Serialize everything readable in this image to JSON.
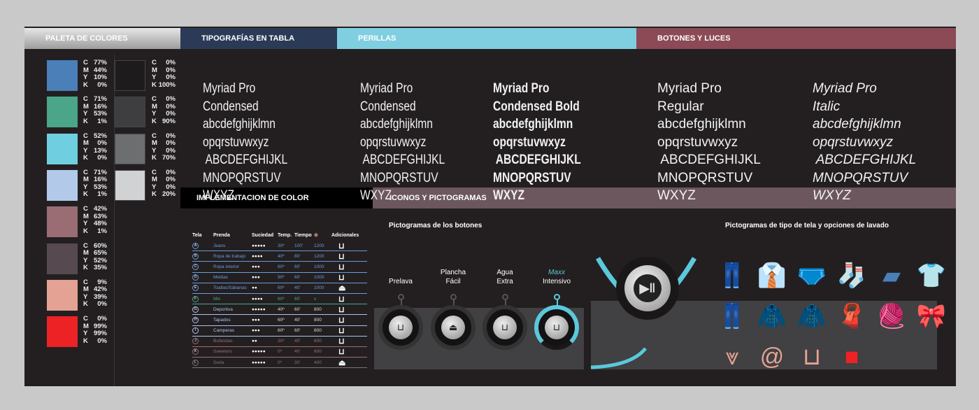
{
  "headers": {
    "palette": "PALETA DE COLORES",
    "typography": "TIPOGRAFÍAS EN   TABLA",
    "knobs": "PERILLAS",
    "buttons": "BOTONES Y LUCES",
    "implementation": "IMPLEMENTACION DE COLOR",
    "icons": "ICONOS Y PICTOGRAMAS"
  },
  "colors": {
    "board": "#231f20",
    "palette_header": "#bdbdbd",
    "typo_header": "#2b3b57",
    "knobs_header": "#7fcfe1",
    "buttons_header": "#8c4a56",
    "icons_header": "#6b575d",
    "accent": "#5bc8dc"
  },
  "palette_left": [
    {
      "hex": "#4a7fb8",
      "c": "77%",
      "m": "44%",
      "y": "10%",
      "k": "0%"
    },
    {
      "hex": "#4aa589",
      "c": "71%",
      "m": "16%",
      "y": "53%",
      "k": "1%"
    },
    {
      "hex": "#6fcfe0",
      "c": "52%",
      "m": "0%",
      "y": "13%",
      "k": "0%"
    },
    {
      "hex": "#b2c9ea",
      "c": "71%",
      "m": "16%",
      "y": "53%",
      "k": "1%"
    },
    {
      "hex": "#9a6c74",
      "c": "42%",
      "m": "63%",
      "y": "48%",
      "k": "1%"
    },
    {
      "hex": "#574950",
      "c": "60%",
      "m": "65%",
      "y": "52%",
      "k": "35%"
    },
    {
      "hex": "#e3a293",
      "c": "9%",
      "m": "42%",
      "y": "39%",
      "k": "0%"
    },
    {
      "hex": "#ed2224",
      "c": "0%",
      "m": "99%",
      "y": "99%",
      "k": "0%"
    }
  ],
  "palette_right": [
    {
      "hex": "#1e1b1c",
      "c": "0%",
      "m": "0%",
      "y": "0%",
      "k": "100%"
    },
    {
      "hex": "#3e3e40",
      "c": "0%",
      "m": "0%",
      "y": "0%",
      "k": "90%"
    },
    {
      "hex": "#6d6e70",
      "c": "0%",
      "m": "0%",
      "y": "0%",
      "k": "70%"
    },
    {
      "hex": "#d1d2d4",
      "c": "0%",
      "m": "0%",
      "y": "0%",
      "k": "20%"
    }
  ],
  "typography": [
    {
      "lines": [
        "Myriad Pro",
        "Condensed",
        "abcdefghijklmn",
        "opqrstuvwxyz",
        " ABCDEFGHIJKL",
        "MNOPQRSTUV",
        "WXYZ"
      ]
    },
    {
      "lines": [
        "Myriad Pro",
        "Condensed",
        "abcdefghijklmn",
        "opqrstuvwxyz",
        " ABCDEFGHIJKL",
        "MNOPQRSTUV",
        "WXYZ"
      ]
    },
    {
      "lines": [
        "Myriad Pro",
        "Condensed Bold",
        "abcdefghijklmn",
        "opqrstuvwxyz",
        " ABCDEFGHIJKL",
        "MNOPQRSTUV",
        "WXYZ"
      ]
    },
    {
      "lines": [
        "Myriad Pro",
        "Regular",
        "abcdefghijklmn",
        "opqrstuvwxyz",
        " ABCDEFGHIJKL",
        "MNOPQRSTUV",
        "WXYZ"
      ]
    },
    {
      "lines": [
        "Myriad Pro",
        "Italic",
        "abcdefghijklmn",
        "opqrstuvwxyz",
        " ABCDEFGHIJKL",
        "MNOPQRSTUV",
        "WXYZ"
      ]
    }
  ],
  "table": {
    "headers": [
      "Tela",
      "Prenda",
      "Suciedad",
      "Temp.",
      "Tiempo",
      "⊚",
      "Adicionales"
    ],
    "rows": [
      [
        "A",
        "Jeans",
        "●●●●●",
        "30º",
        "100'",
        "1200",
        "wash-star",
        "#6a9ad8"
      ],
      [
        "B",
        "Ropa de trabajo",
        "●●●●",
        "40º",
        "80'",
        "1200",
        "wash",
        "#6a9ad8"
      ],
      [
        "C",
        "Ropa interior",
        "●●●",
        "60º",
        "60'",
        "1000",
        "wash",
        "#6a9ad8"
      ],
      [
        "D",
        "Medias",
        "●●●",
        "90º",
        "60'",
        "1000",
        "wash-star",
        "#6a9ad8"
      ],
      [
        "E",
        "Toallas/Sábanas",
        "●●",
        "60º",
        "40'",
        "1000",
        "iron",
        "#6a9ad8"
      ],
      [
        "F",
        "Mix",
        "●●●●",
        "60º",
        "60'",
        "x",
        "wash",
        "#4aa589"
      ],
      [
        "G",
        "Deportiva",
        "●●●●●",
        "40º",
        "60'",
        "800",
        "wash",
        "#a9c4ec"
      ],
      [
        "H",
        "Tapados",
        "●●●",
        "60º",
        "40'",
        "800",
        "wash",
        "#a9c4ec"
      ],
      [
        "I",
        "Camperas",
        "●●●",
        "60º",
        "60'",
        "800",
        "wash",
        "#a9c4ec"
      ],
      [
        "J",
        "Bufandas",
        "●●",
        "30º",
        "40'",
        "600",
        "wash",
        "#9a6c74"
      ],
      [
        "K",
        "Sweeters",
        "●●●●●",
        "0º",
        "40'",
        "600",
        "wash",
        "#9a6c74"
      ],
      [
        "L",
        "Seda",
        "●●●●●",
        "0º",
        "30'",
        "400",
        "iron",
        "#777"
      ]
    ]
  },
  "knobs": {
    "title": "Pictogramas de los botones",
    "items": [
      {
        "line1": "",
        "line2": "Prelava",
        "active": false,
        "icon": "prewash-icon"
      },
      {
        "line1": "Plancha",
        "line2": "Fácil",
        "active": false,
        "icon": "iron-icon"
      },
      {
        "line1": "Agua",
        "line2": "Extra",
        "active": false,
        "icon": "extra-water-icon"
      },
      {
        "line1": "Maxx",
        "line2": "Intensivo",
        "active": true,
        "icon": "intensive-icon"
      }
    ]
  },
  "pictograms": {
    "title": "Pictogramas de tipo de tela y opciones de lavado"
  }
}
